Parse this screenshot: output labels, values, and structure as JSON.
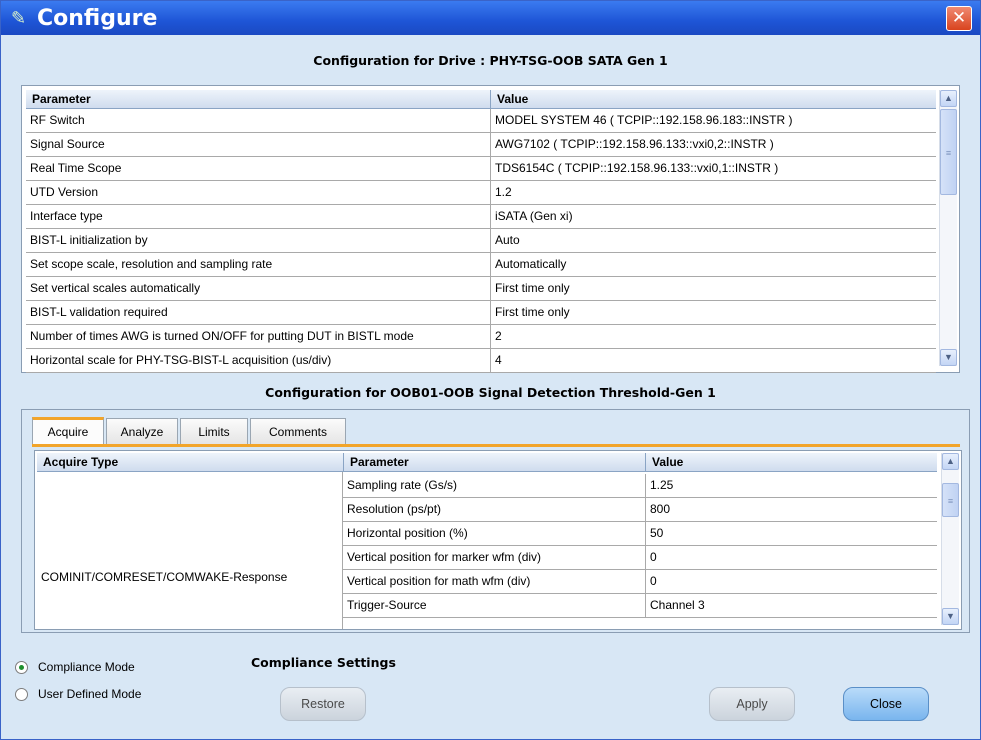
{
  "window": {
    "title": "Configure"
  },
  "drive": {
    "header": "Configuration for Drive : PHY-TSG-OOB SATA Gen 1",
    "columns": [
      "Parameter",
      "Value"
    ],
    "rows": [
      [
        "RF Switch",
        "MODEL SYSTEM 46 ( TCPIP::192.158.96.183::INSTR )"
      ],
      [
        "Signal Source",
        "AWG7102 ( TCPIP::192.158.96.133::vxi0,2::INSTR )"
      ],
      [
        "Real Time Scope",
        "TDS6154C ( TCPIP::192.158.96.133::vxi0,1::INSTR )"
      ],
      [
        "UTD Version",
        "1.2"
      ],
      [
        "Interface type",
        "iSATA (Gen xi)"
      ],
      [
        "BIST-L initialization by",
        "Auto"
      ],
      [
        "Set scope scale, resolution and sampling rate",
        "Automatically"
      ],
      [
        "Set vertical scales automatically",
        "First time only"
      ],
      [
        "BIST-L validation required",
        "First time only"
      ],
      [
        "Number of times AWG is turned ON/OFF for putting DUT in BISTL mode",
        "2"
      ],
      [
        "Horizontal scale for PHY-TSG-BIST-L acquisition (us/div)",
        "4"
      ]
    ]
  },
  "test": {
    "header": "Configuration for OOB01-OOB Signal Detection Threshold-Gen 1",
    "tabs": [
      "Acquire",
      "Analyze",
      "Limits",
      "Comments"
    ],
    "columns": [
      "Acquire Type",
      "Parameter",
      "Value"
    ],
    "acquire_type": "COMINIT/COMRESET/COMWAKE-Response",
    "rows": [
      [
        "Sampling rate (Gs/s)",
        "1.25"
      ],
      [
        "Resolution (ps/pt)",
        "800"
      ],
      [
        "Horizontal position (%)",
        "50"
      ],
      [
        "Vertical position for marker wfm (div)",
        "0"
      ],
      [
        "Vertical position for math wfm (div)",
        "0"
      ],
      [
        "Trigger-Source",
        "Channel 3"
      ]
    ]
  },
  "modes": {
    "compliance": "Compliance Mode",
    "user_defined": "User Defined Mode",
    "selected": "compliance"
  },
  "compliance_settings": "Compliance Settings",
  "buttons": {
    "restore": "Restore",
    "apply": "Apply",
    "close": "Close"
  },
  "icons": {
    "title": "configure-tools-icon",
    "close": "close-icon",
    "scroll_up": "chevron-up-icon",
    "scroll_down": "chevron-down-icon"
  }
}
